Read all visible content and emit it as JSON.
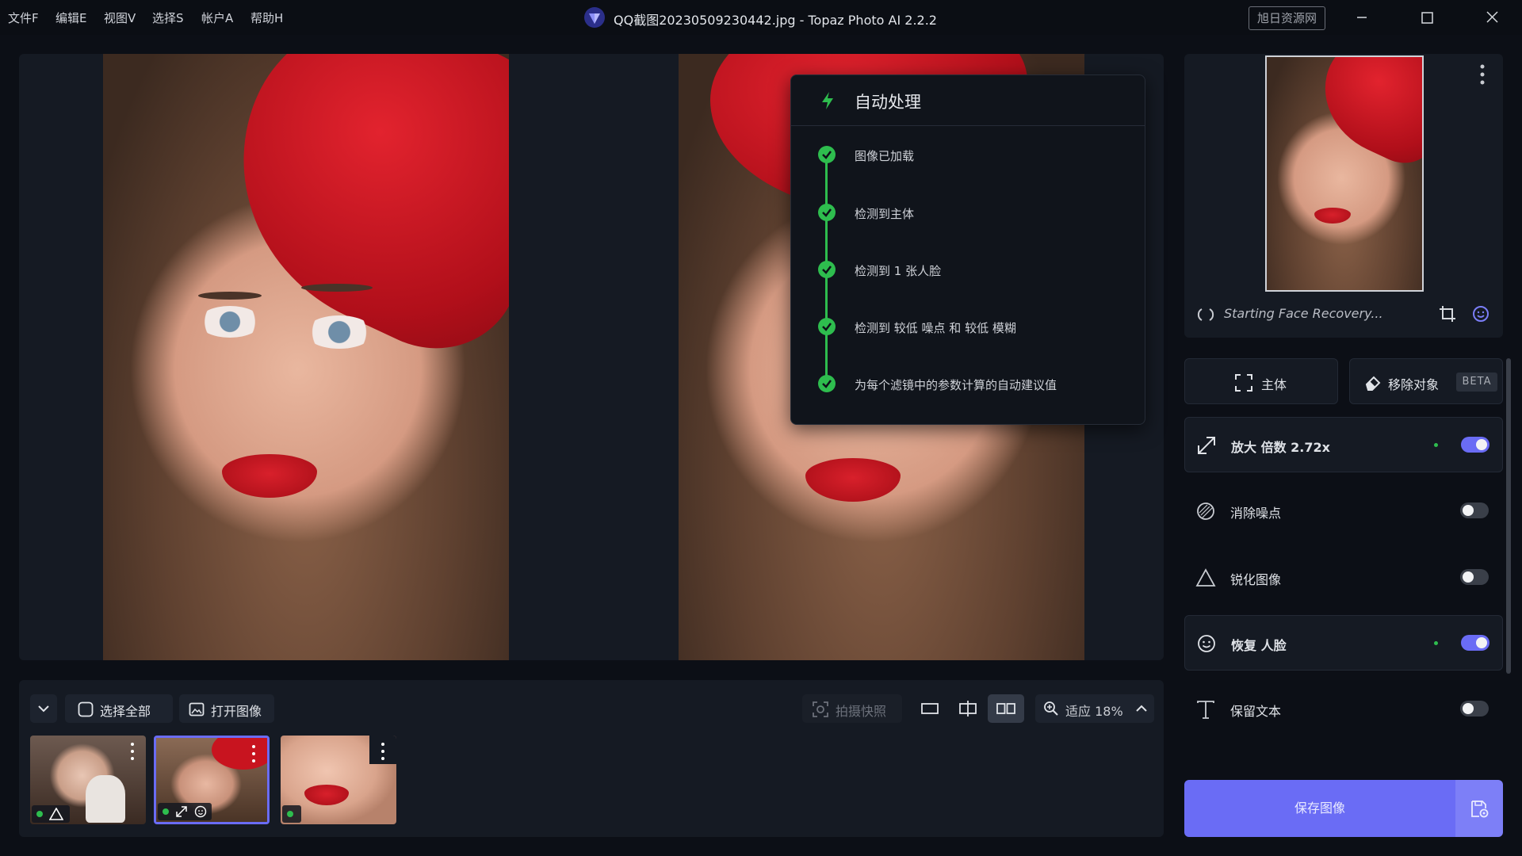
{
  "menu": [
    "文件F",
    "编辑E",
    "视图V",
    "选择S",
    "帐户A",
    "帮助H"
  ],
  "window": {
    "title": "QQ截图20230509230442.jpg - Topaz Photo AI 2.2.2",
    "watermark": "旭日资源网",
    "controls": [
      "minimize-icon",
      "maximize-icon",
      "close-icon"
    ]
  },
  "auto_panel": {
    "title": "自动处理",
    "steps": [
      {
        "label": "图像已加载",
        "done": true
      },
      {
        "label": "检测到主体",
        "done": true
      },
      {
        "label": "检测到 1 张人脸",
        "done": true
      },
      {
        "label": "检测到 较低  噪点 和 较低  模糊",
        "done": true
      },
      {
        "label": "为每个滤镜中的参数计算的自动建议值",
        "done": true
      }
    ]
  },
  "preview": {
    "status": "Starting Face Recovery..."
  },
  "tools": {
    "subject_label": "主体",
    "remove_label": "移除对象",
    "beta_label": "BETA"
  },
  "filters": [
    {
      "icon": "upscale-icon",
      "label": "放大 倍数 2.72x",
      "enabled": true,
      "applied": true
    },
    {
      "icon": "denoise-icon",
      "label": "消除噪点",
      "enabled": false,
      "applied": false
    },
    {
      "icon": "sharpen-icon",
      "label": "锐化图像",
      "enabled": false,
      "applied": false
    },
    {
      "icon": "face-recovery-icon",
      "label": "恢复 人脸",
      "enabled": true,
      "applied": true
    },
    {
      "icon": "text-icon",
      "label": "保留文本",
      "enabled": false,
      "applied": false
    }
  ],
  "save": {
    "label": "保存图像"
  },
  "bottom_bar": {
    "select_all": "选择全部",
    "open_image": "打开图像",
    "snapshot": "拍摄快照",
    "zoom": "适应 18%",
    "thumbnails": [
      {
        "status": "processed",
        "badges": [
          "sharpen-icon"
        ],
        "selected": false
      },
      {
        "status": "processed",
        "badges": [
          "upscale-icon",
          "face-recovery-icon"
        ],
        "selected": true
      },
      {
        "status": "processed",
        "badges": [],
        "selected": false
      }
    ]
  },
  "colors": {
    "accent": "#6a6cf5",
    "success": "#2ebd4e",
    "background": "#0c0f16",
    "panel": "#151a23"
  }
}
